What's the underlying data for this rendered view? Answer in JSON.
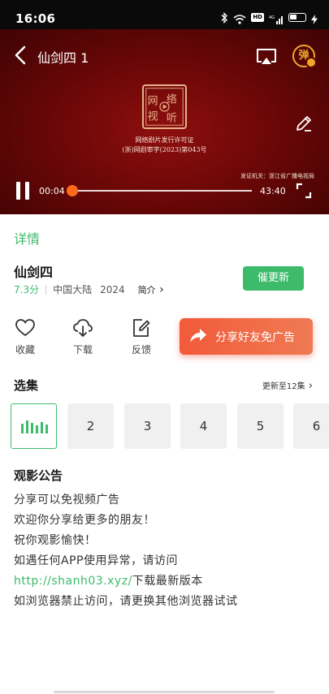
{
  "status_bar": {
    "time": "16:06",
    "hd_badge": "HD",
    "icons": [
      "bluetooth-icon",
      "wifi-icon",
      "hd-badge",
      "signal-4g-icon",
      "battery-icon",
      "charging-icon"
    ]
  },
  "player": {
    "title": "仙剑四 1",
    "danmu_label": "弹",
    "license_line1": "网络剧片发行许可证",
    "license_line2": "(浙)网剧审字(2023)第043号",
    "issuer": "发证机关：浙江省广播电视局",
    "time_current": "00:04",
    "time_total": "43:40",
    "progress_fraction": 0.0015,
    "accent_color": "#ff6a1a"
  },
  "details": {
    "tab_label": "详情",
    "title": "仙剑四",
    "rating": "7.3分",
    "region": "中国大陆",
    "year": "2024",
    "intro_label": "简介",
    "update_button": "催更新",
    "accent_color": "#3dbb6b"
  },
  "actions": {
    "favorite": "收藏",
    "download": "下载",
    "feedback": "反馈",
    "share": "分享好友免广告"
  },
  "episodes": {
    "title": "选集",
    "more": "更新至12集",
    "items": [
      "2",
      "3",
      "4",
      "5",
      "6"
    ]
  },
  "notice": {
    "title": "观影公告",
    "line1": "分享可以免视频广告",
    "line2": "欢迎你分享给更多的朋友！",
    "line3": "祝你观影愉快！",
    "line4": "如遇任何APP使用异常，请访问",
    "line5_url": "http://shanh03.xyz/",
    "line5_rest": "下载最新版本",
    "line6": "如浏览器禁止访问，请更换其他浏览器试试"
  }
}
